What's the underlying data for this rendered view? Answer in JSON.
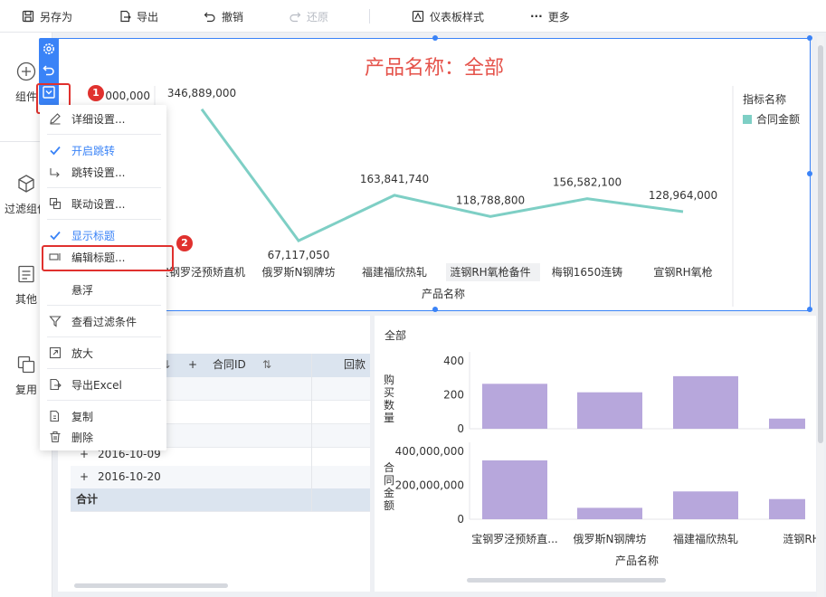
{
  "toolbar": {
    "save_as": "另存为",
    "export": "导出",
    "undo": "撤销",
    "redo": "还原",
    "dashboard_style": "仪表板样式",
    "more": "更多"
  },
  "sidebar": {
    "items": [
      {
        "label": "组件",
        "icon": "add-circle-icon"
      },
      {
        "label": "过滤组件",
        "icon": "cube-icon"
      },
      {
        "label": "其他",
        "icon": "document-icon"
      },
      {
        "label": "复用",
        "icon": "copy-icon"
      }
    ]
  },
  "line_chart": {
    "title": "产品名称：全部",
    "legend_title": "指标名称",
    "legend_item": "合同金额",
    "line_color": "#7ecfc5",
    "y_tick_top": "000,000",
    "xlabel": "产品名称"
  },
  "chart_data": [
    {
      "type": "line",
      "title": "产品名称：全部",
      "xlabel": "产品名称",
      "categories": [
        "宝钢罗泾预矫直机",
        "俄罗斯N钢牌坊",
        "福建福欣热轧",
        "涟钢RH氧枪备件",
        "梅钢1650连铸",
        "宣钢RH氧枪"
      ],
      "series": [
        {
          "name": "合同金额",
          "values": [
            346889000,
            67117050,
            163841740,
            118788800,
            156582100,
            128964000
          ]
        }
      ],
      "data_labels": [
        "346,889,000",
        "67,117,050",
        "163,841,740",
        "118,788,800",
        "156,582,100",
        "128,964,000"
      ]
    },
    {
      "type": "bar",
      "title": "全部",
      "xlabel": "产品名称",
      "categories": [
        "宝钢罗泾预矫直...",
        "俄罗斯N钢牌坊",
        "福建福欣热轧",
        "涟钢RH"
      ],
      "series": [
        {
          "name": "购买数量",
          "values": [
            265,
            215,
            310,
            60
          ],
          "ylim": [
            0,
            400
          ],
          "ticks": [
            "400",
            "200",
            "0"
          ]
        },
        {
          "name": "合同金额",
          "values": [
            346889000,
            67117050,
            163841740,
            118788800
          ],
          "ylim": [
            0,
            400000000
          ],
          "ticks": [
            "400,000,000",
            "200,000,000",
            "0"
          ]
        }
      ],
      "bar_color": "#b7a7dc"
    }
  ],
  "mini_toolbar": {
    "icons": [
      "gear-icon",
      "undo-icon",
      "dropdown-icon"
    ]
  },
  "badges": {
    "step1": "1",
    "step2": "2"
  },
  "context_menu": {
    "items": [
      {
        "label": "详细设置...",
        "icon": "edit-icon",
        "checked": false
      },
      {
        "label": "开启跳转",
        "icon": "check-icon",
        "checked": true
      },
      {
        "label": "跳转设置...",
        "icon": "jump-icon",
        "checked": false
      },
      {
        "label": "联动设置...",
        "icon": "link-icon",
        "checked": false
      },
      {
        "label": "显示标题",
        "icon": "check-icon",
        "checked": true
      },
      {
        "label": "编辑标题...",
        "icon": "edit-title-icon",
        "checked": false
      },
      {
        "label": "悬浮",
        "icon": "",
        "checked": false
      },
      {
        "label": "查看过滤条件",
        "icon": "filter-icon",
        "checked": false
      },
      {
        "label": "放大",
        "icon": "expand-icon",
        "checked": false
      },
      {
        "label": "导出Excel",
        "icon": "export-excel-icon",
        "checked": false
      },
      {
        "label": "复制",
        "icon": "copy-icon",
        "checked": false
      },
      {
        "label": "删除",
        "icon": "trash-icon",
        "checked": false
      }
    ]
  },
  "table": {
    "header_cols": [
      "合同ID",
      "回款"
    ],
    "rows": [
      "2016-10-09",
      "2016-10-20"
    ],
    "total_label": "合计"
  },
  "bar_chart": {
    "title": "全部",
    "y1_label": "购买数量",
    "y2_label": "合同金额",
    "xlabel": "产品名称"
  }
}
